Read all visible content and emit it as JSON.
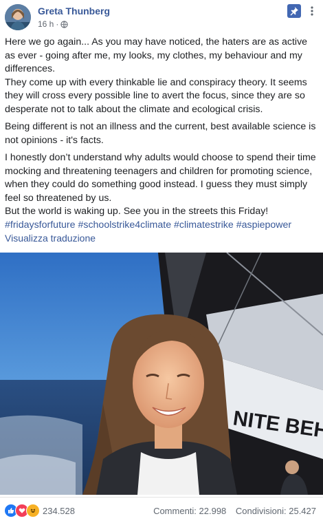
{
  "post": {
    "author": "Greta Thunberg",
    "time": "16 h",
    "separator": "·",
    "paragraphs": [
      [
        "Here we go again... As you may have noticed, the haters are as active",
        "as ever - going after me, my looks, my clothes, my behaviour and my",
        "differences.",
        "They come up with every thinkable lie and conspiracy theory. It seems",
        "they will cross every possible line to avert the focus, since they are so",
        "desperate not to talk about the climate and ecological crisis."
      ],
      [
        "Being different is not an illness and the current, best available science is",
        "not opinions - it's facts."
      ],
      [
        "I honestly don’t understand why adults would choose to spend their time",
        "mocking and threatening teenagers and children for promoting science,",
        "when they could do something good instead. I guess they must simply",
        "feel so threatened by us.",
        "But the world is waking up. See you in the streets this Friday!"
      ]
    ],
    "hashtags": "#fridaysforfuture #schoolstrike4climate #climatestrike #aspiepower",
    "translate_link": "Visualizza traduzione",
    "photo_sail_text": "NITE BEHI",
    "icons": {
      "pin": "pin-icon",
      "menu": "more-icon",
      "globe": "globe-icon"
    }
  },
  "footer": {
    "reaction_count": "234.528",
    "comments": "Commenti: 22.998",
    "shares": "Condivisioni: 25.427"
  },
  "colors": {
    "link": "#385898",
    "brand": "#4267b2",
    "text": "#1c1e21",
    "muted": "#606770"
  }
}
